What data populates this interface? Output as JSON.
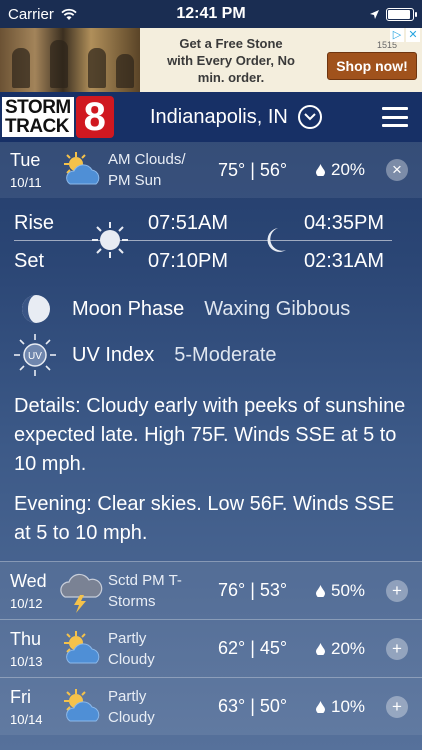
{
  "status": {
    "carrier": "Carrier",
    "time": "12:41 PM"
  },
  "ad": {
    "text_line1": "Get a Free Stone",
    "text_line2": "with Every Order, No",
    "text_line3": "min. order.",
    "button": "Shop now!",
    "logo_text": "1515"
  },
  "header": {
    "logo_line1": "STORM",
    "logo_line2": "TRACK",
    "logo_number": "8",
    "city": "Indianapolis, IN"
  },
  "today": {
    "day": "Tue",
    "date": "10/11",
    "condition_line1": "AM Clouds/",
    "condition_line2": "PM Sun",
    "temps": "75° | 56°",
    "precip": "20%",
    "icon": "partly-cloudy-icon",
    "action": "×"
  },
  "sun": {
    "rise_label": "Rise",
    "set_label": "Set",
    "sunrise": "07:51AM",
    "sunset": "07:10PM",
    "moonrise": "04:35PM",
    "moonset": "02:31AM"
  },
  "moon": {
    "label": "Moon Phase",
    "value": "Waxing Gibbous"
  },
  "uv": {
    "label": "UV Index",
    "value": "5-Moderate",
    "icon_text": "UV"
  },
  "details": "Details: Cloudy early with peeks of sunshine expected late. High 75F. Winds SSE at 5 to 10 mph.",
  "evening": "Evening: Clear skies. Low 56F. Winds SSE at 5 to 10 mph.",
  "forecast": [
    {
      "day": "Wed",
      "date": "10/12",
      "cond1": "Sctd PM T-",
      "cond2": "Storms",
      "temps": "76° | 53°",
      "precip": "50%",
      "icon": "thunderstorm-icon",
      "action": "+"
    },
    {
      "day": "Thu",
      "date": "10/13",
      "cond1": "Partly",
      "cond2": "Cloudy",
      "temps": "62° | 45°",
      "precip": "20%",
      "icon": "partly-cloudy-icon",
      "action": "+"
    },
    {
      "day": "Fri",
      "date": "10/14",
      "cond1": "Partly",
      "cond2": "Cloudy",
      "temps": "63° | 50°",
      "precip": "10%",
      "icon": "partly-cloudy-icon",
      "action": "+"
    }
  ],
  "colors": {
    "header_bg": "#173066",
    "logo_red": "#d01820",
    "ad_button": "#a0521c"
  }
}
